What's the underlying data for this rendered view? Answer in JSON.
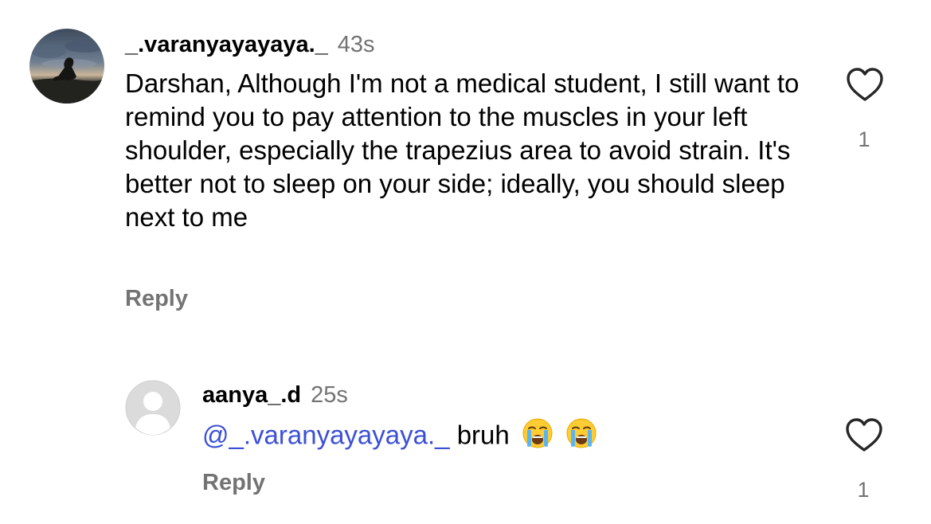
{
  "comments": [
    {
      "username": "_.varanyayayaya._",
      "time": "43s",
      "text": "Darshan, Although I'm not a medical student, I still want to remind you to pay attention to the muscles in your left shoulder, especially the trapezius area to avoid strain. It's better not to sleep on your side; ideally, you should sleep next to me",
      "reply_label": "Reply",
      "like_count": "1",
      "avatar_icon": "profile-photo-sunset-icon"
    },
    {
      "username": "aanya_.d",
      "time": "25s",
      "mention": "@_.varanyayayaya._",
      "text": "bruh",
      "emoji": [
        "loudly-crying-face-icon",
        "loudly-crying-face-icon"
      ],
      "reply_label": "Reply",
      "like_count": "1",
      "avatar_icon": "default-user-avatar-icon"
    }
  ],
  "colors": {
    "text": "#000000",
    "secondary": "#737373",
    "mention": "#3b4fd6",
    "background": "#ffffff"
  }
}
